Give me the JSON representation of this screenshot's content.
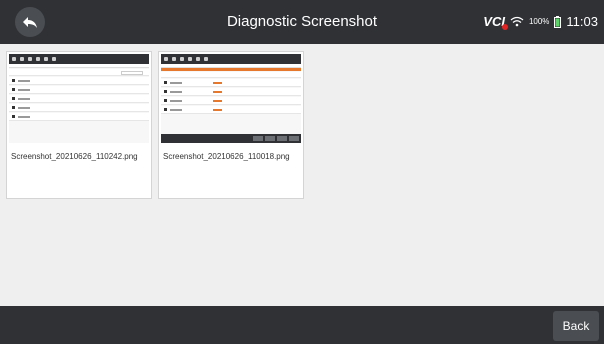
{
  "header": {
    "title": "Diagnostic Screenshot"
  },
  "status": {
    "vci_label": "VCI",
    "battery": "100%",
    "time": "11:03"
  },
  "files": [
    {
      "name": "Screenshot_20210626_110242.png"
    },
    {
      "name": "Screenshot_20210626_110018.png"
    }
  ],
  "footer": {
    "back_label": "Back"
  }
}
